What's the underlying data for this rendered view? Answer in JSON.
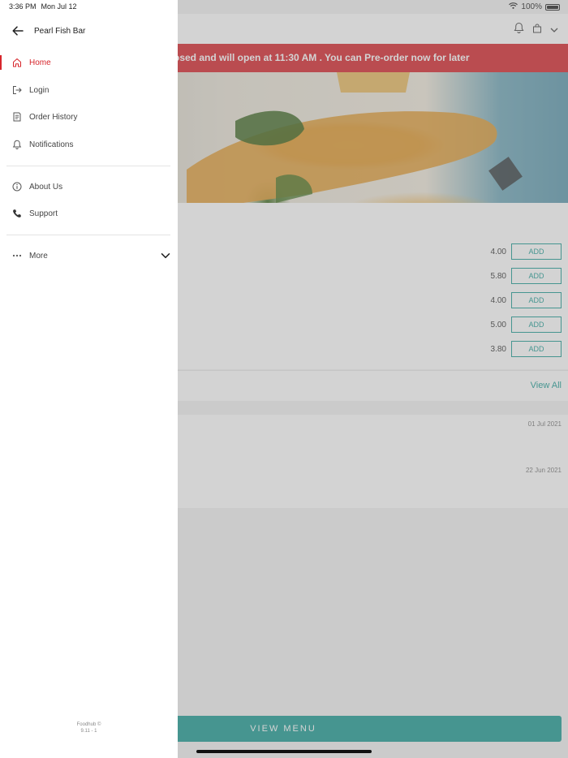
{
  "status_bar": {
    "time": "3:36 PM",
    "date": "Mon Jul 12",
    "battery": "100%"
  },
  "drawer": {
    "shop_name": "Pearl Fish Bar",
    "items": [
      {
        "label": "Home",
        "icon": "home-icon",
        "active": true
      },
      {
        "label": "Login",
        "icon": "login-icon"
      },
      {
        "label": "Order History",
        "icon": "receipt-icon"
      },
      {
        "label": "Notifications",
        "icon": "bell-icon"
      },
      {
        "label": "About Us",
        "icon": "info-icon"
      },
      {
        "label": "Support",
        "icon": "phone-icon"
      },
      {
        "label": "More",
        "icon": "more-icon"
      }
    ],
    "footer_brand": "Foodhub ©",
    "footer_version": "9.11 - 1"
  },
  "background": {
    "banner_text": "osed and will open at 11:30 AM . You can Pre-order now for later",
    "menu_items": [
      {
        "price": "4.00",
        "button": "ADD"
      },
      {
        "price": "5.80",
        "button": "ADD"
      },
      {
        "price": "4.00",
        "button": "ADD"
      },
      {
        "price": "5.00",
        "button": "ADD"
      },
      {
        "price": "3.80",
        "button": "ADD"
      }
    ],
    "view_all": "View All",
    "review_dates": [
      "01 Jul 2021",
      "22 Jun 2021"
    ],
    "view_menu": "VIEW MENU"
  },
  "colors": {
    "accent_red": "#d7262c",
    "teal": "#1c9c94"
  }
}
